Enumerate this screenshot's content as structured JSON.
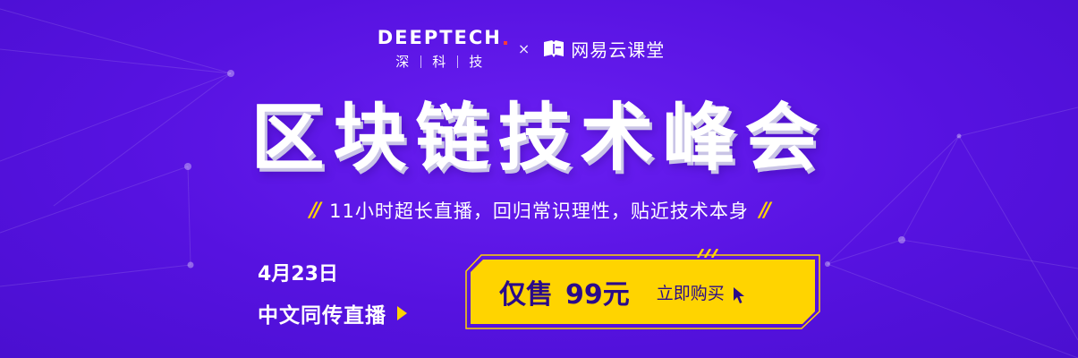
{
  "brands": {
    "deeptech_wordmark": "DEEPTECH",
    "deeptech_chars": [
      "深",
      "科",
      "技"
    ],
    "collab_mark": "×",
    "partner_name": "网易云课堂"
  },
  "title": "区块链技术峰会",
  "subtitle": {
    "left_mark": "//",
    "text": "11小时超长直播，回归常识理性，贴近技术本身",
    "right_mark": "//"
  },
  "event": {
    "date": "4月23日",
    "live_label": "中文同传直播"
  },
  "purchase": {
    "price_label": "仅售",
    "price_value": "99元",
    "buy_label": "立即购买"
  },
  "colors": {
    "background": "#5612e0",
    "accent_yellow": "#ffd400",
    "price_text": "#2a0a8a",
    "deeptech_dot": "#ff3a3a"
  },
  "icons": [
    "netease-book-icon",
    "play-triangle-icon",
    "cursor-arrow-icon"
  ]
}
